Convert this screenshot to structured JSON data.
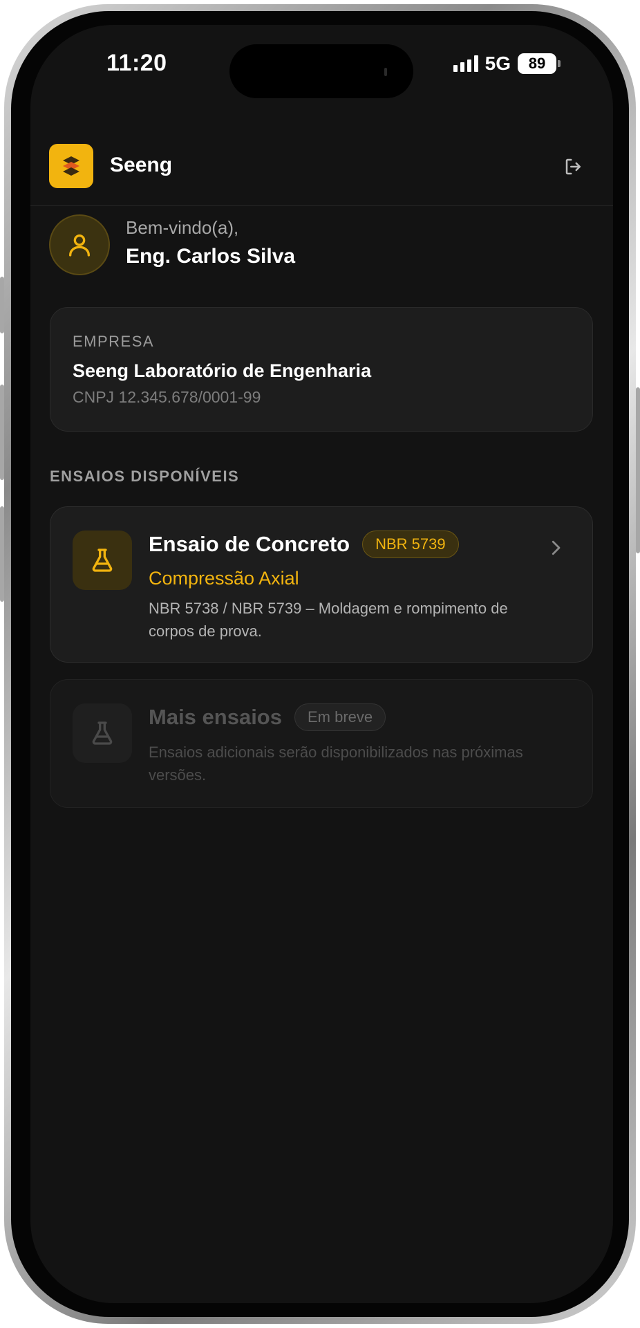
{
  "status_bar": {
    "time": "11:20",
    "network": "5G",
    "battery": "89"
  },
  "header": {
    "app_name": "Seeng",
    "logo_icon": "seeng-logo-icon",
    "logout_icon": "logout-icon"
  },
  "welcome": {
    "greeting": "Bem-vindo(a),",
    "user_name": "Eng. Carlos Silva",
    "avatar_icon": "user-icon"
  },
  "company": {
    "caption": "EMPRESA",
    "name": "Seeng Laboratório de Engenharia",
    "cnpj": "CNPJ 12.345.678/0001-99"
  },
  "tests_section": {
    "title": "ENSAIOS DISPONÍVEIS",
    "items": [
      {
        "title": "Ensaio de Concreto",
        "badge": "NBR 5739",
        "subtitle": "Compressão Axial",
        "description": "NBR 5738 / NBR 5739 – Moldagem e rompimento de corpos de prova.",
        "icon": "flask-icon",
        "chevron_icon": "chevron-right-icon"
      },
      {
        "title": "Mais ensaios",
        "badge": "Em breve",
        "description": "Ensaios adicionais serão disponibilizados nas próximas versões.",
        "icon": "flask-icon"
      }
    ]
  },
  "colors": {
    "accent": "#f2b40f",
    "background": "#131313",
    "card": "#1d1d1d"
  }
}
